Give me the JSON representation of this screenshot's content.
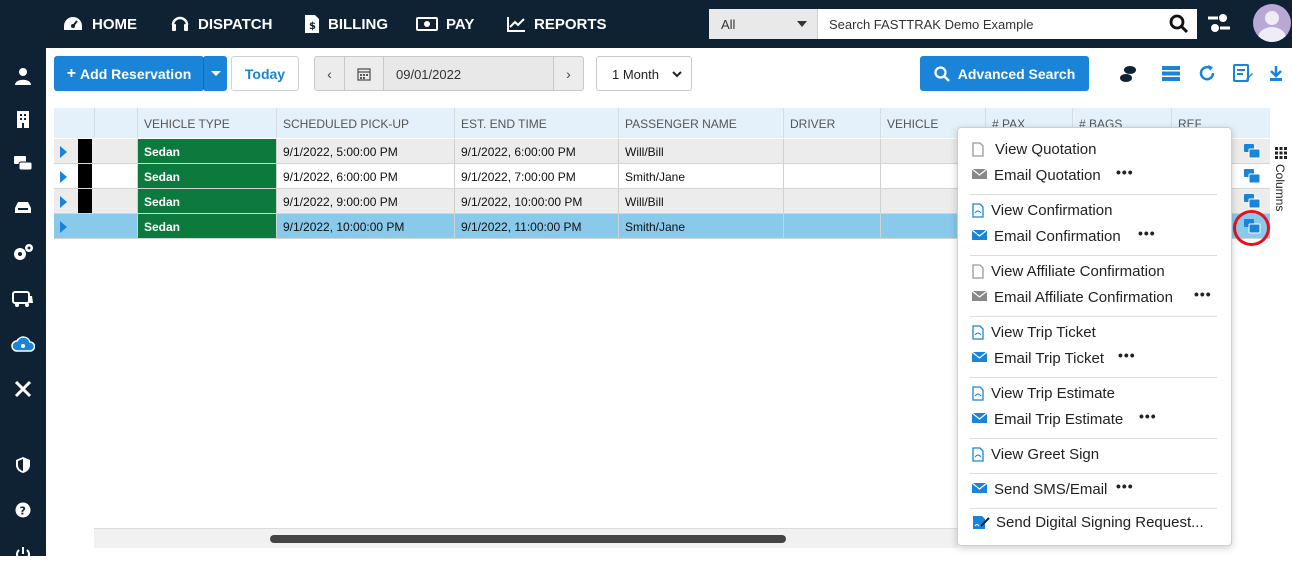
{
  "nav": {
    "items": [
      {
        "label": "HOME",
        "icon": "dashboard-icon"
      },
      {
        "label": "DISPATCH",
        "icon": "headset-icon"
      },
      {
        "label": "BILLING",
        "icon": "invoice-icon"
      },
      {
        "label": "PAY",
        "icon": "money-icon"
      },
      {
        "label": "REPORTS",
        "icon": "chart-line-icon"
      }
    ],
    "search_scope": "All",
    "search_placeholder": "Search FASTTRAK Demo Example"
  },
  "toolbar": {
    "add_reservation": "Add Reservation",
    "today": "Today",
    "date": "09/01/2022",
    "range": "1 Month",
    "advanced_search": "Advanced Search"
  },
  "grid": {
    "columns": [
      "VEHICLE TYPE",
      "SCHEDULED PICK-UP",
      "EST. END TIME",
      "PASSENGER NAME",
      "DRIVER",
      "VEHICLE",
      "# PAX",
      "# BAGS",
      "REF"
    ],
    "rows": [
      {
        "vehicle_type": "Sedan",
        "pickup": "9/1/2022, 5:00:00 PM",
        "end": "9/1/2022, 6:00:00 PM",
        "passenger": "Will/Bill"
      },
      {
        "vehicle_type": "Sedan",
        "pickup": "9/1/2022, 6:00:00 PM",
        "end": "9/1/2022, 7:00:00 PM",
        "passenger": "Smith/Jane"
      },
      {
        "vehicle_type": "Sedan",
        "pickup": "9/1/2022, 9:00:00 PM",
        "end": "9/1/2022, 10:00:00 PM",
        "passenger": "Will/Bill"
      },
      {
        "vehicle_type": "Sedan",
        "pickup": "9/1/2022, 10:00:00 PM",
        "end": "9/1/2022, 11:00:00 PM",
        "passenger": "Smith/Jane"
      }
    ],
    "columns_panel_label": "Columns"
  },
  "menu": {
    "items": [
      {
        "label": "View Quotation",
        "icon": "pdf-icon",
        "more": false
      },
      {
        "label": "Email Quotation",
        "icon": "envelope-icon",
        "more": true
      },
      {
        "label": "View Confirmation",
        "icon": "pdf-icon",
        "more": false
      },
      {
        "label": "Email Confirmation",
        "icon": "envelope-icon",
        "more": true
      },
      {
        "label": "View Affiliate Confirmation",
        "icon": "pdf-icon",
        "more": false
      },
      {
        "label": "Email Affiliate Confirmation",
        "icon": "envelope-icon",
        "more": true
      },
      {
        "label": "View Trip Ticket",
        "icon": "pdf-icon",
        "more": false
      },
      {
        "label": "Email Trip Ticket",
        "icon": "envelope-icon",
        "more": true
      },
      {
        "label": "View Trip Estimate",
        "icon": "pdf-icon",
        "more": false
      },
      {
        "label": "Email Trip Estimate",
        "icon": "envelope-icon",
        "more": true
      },
      {
        "label": "View Greet Sign",
        "icon": "pdf-icon",
        "more": false
      },
      {
        "label": "Send SMS/Email",
        "icon": "envelope-icon",
        "more": true
      },
      {
        "label": "Send Digital Signing Request...",
        "icon": "signature-icon",
        "more": false
      }
    ],
    "more_glyph": "•••"
  },
  "colors": {
    "topbar": "#0f2233",
    "accent": "#1a84d8",
    "vehicle_cell": "#0b7a3c",
    "selected_row": "#89c9ea",
    "highlight": "#e8101a"
  }
}
